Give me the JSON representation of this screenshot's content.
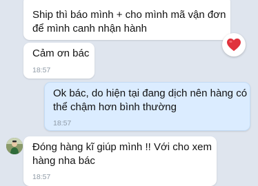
{
  "colors": {
    "background": "#dfe5ee",
    "incoming_bubble": "#ffffff",
    "outgoing_bubble": "#dbecff",
    "timestamp": "#8f9aa6",
    "reaction_heart": "#e0323c"
  },
  "messages": [
    {
      "direction": "incoming",
      "text": "Ship thì báo mình + cho mình mã vận đơn\nđể mình canh nhận hành",
      "reaction": "heart-icon"
    },
    {
      "direction": "incoming",
      "text": "Cảm ơn bác",
      "time": "18:57"
    },
    {
      "direction": "outgoing",
      "text": "Ok bác, do hiện tại đang dịch nên hàng có\nthể chậm hơn bình thường",
      "time": "18:57"
    },
    {
      "direction": "incoming",
      "text": "Đóng hàng kĩ giúp mình !! Với cho xem\nhàng nha bác",
      "time": "18:57",
      "avatar": "contact-avatar"
    }
  ]
}
